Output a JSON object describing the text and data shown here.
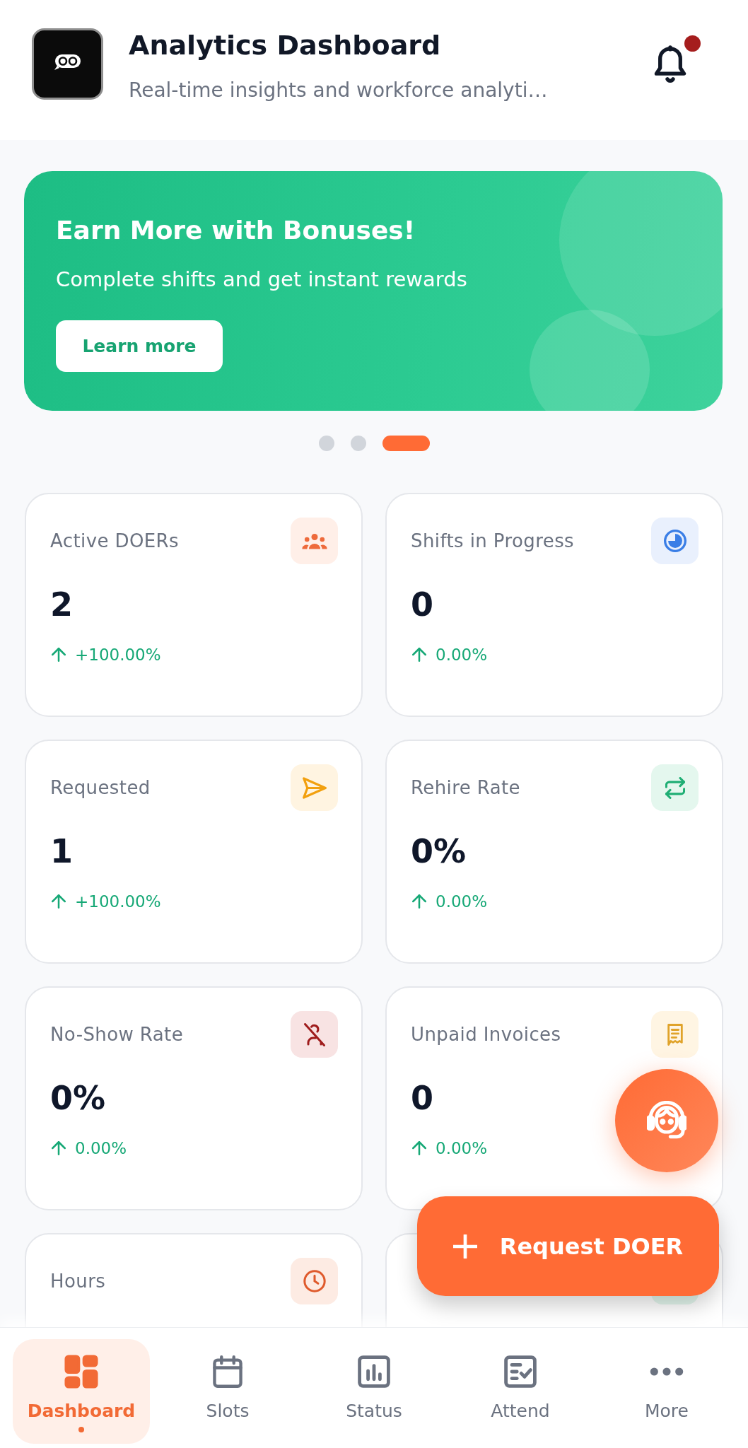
{
  "header": {
    "title": "Analytics Dashboard",
    "subtitle": "Real-time insights and workforce analyti…",
    "notifications": {
      "unread": true
    }
  },
  "banner": {
    "title": "Earn More with Bonuses!",
    "text": "Complete shifts and get instant rewards",
    "button": "Learn more"
  },
  "carousel_dots": [
    {
      "selected": false
    },
    {
      "selected": false
    },
    {
      "selected": true
    }
  ],
  "metrics": [
    {
      "kind": "doers",
      "label": "Active DOERs",
      "value": "2",
      "rising": true,
      "change": "+100.00%"
    },
    {
      "kind": "shifts",
      "label": "Shifts in Progress",
      "value": "0",
      "rising": true,
      "change": "0.00%"
    },
    {
      "kind": "requested",
      "label": "Requested",
      "value": "1",
      "rising": true,
      "change": "+100.00%"
    },
    {
      "kind": "rehire",
      "label": "Rehire Rate",
      "value": "0%",
      "rising": true,
      "change": "0.00%"
    },
    {
      "kind": "noshow",
      "label": "No-Show Rate",
      "value": "0%",
      "rising": true,
      "change": "0.00%"
    },
    {
      "kind": "invoices",
      "label": "Unpaid Invoices",
      "value": "0",
      "rising": true,
      "change": "0.00%"
    },
    {
      "kind": "hours",
      "label": "Hours"
    },
    {
      "kind": "covered"
    }
  ],
  "request_button": {
    "label": "Request DOER"
  },
  "bottom_nav": [
    {
      "kind": "dashboard",
      "label": "Dashboard",
      "selected": true
    },
    {
      "kind": "slots",
      "label": "Slots",
      "selected": false
    },
    {
      "kind": "status",
      "label": "Status",
      "selected": false
    },
    {
      "kind": "attend",
      "label": "Attend",
      "selected": false
    },
    {
      "kind": "more",
      "label": "More",
      "selected": false
    }
  ]
}
